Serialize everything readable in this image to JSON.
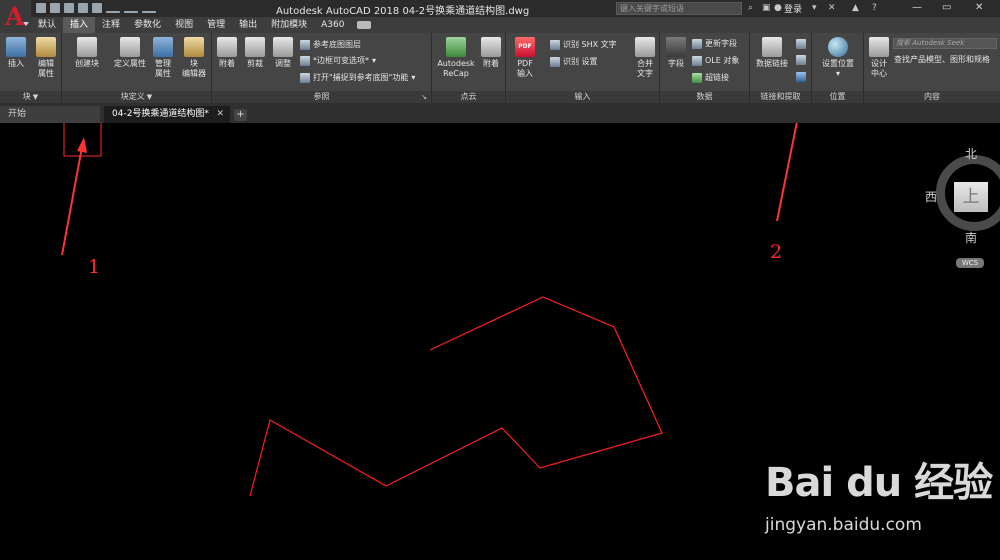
{
  "titlebar": {
    "document_title": "Autodesk AutoCAD 2018    04-2号换乘通道结构图.dwg",
    "search_placeholder": "键入关键字或短语",
    "login_label": "登录"
  },
  "ribbon_tabs": [
    "默认",
    "插入",
    "注释",
    "参数化",
    "视图",
    "管理",
    "输出",
    "附加模块",
    "A360"
  ],
  "active_tab": "插入",
  "ribbon": {
    "block": {
      "label": "块",
      "insert": "插入",
      "edit_attr_1": "编辑",
      "edit_attr_2": "属性",
      "create_block": "创建块"
    },
    "block_def": {
      "label": "块定义",
      "define_attr": "定义属性",
      "manage_attr_1": "管理",
      "manage_attr_2": "属性",
      "block_editor_1": "块",
      "block_editor_2": "编辑器"
    },
    "reference": {
      "label": "参照",
      "attach": "附着",
      "clip": "剪裁",
      "adjust": "调整",
      "underlay_layers": "参考底图图层",
      "frame_options": "*边框可变选项*",
      "snap_underlay": "打开\"捕捉到参考底图\"功能"
    },
    "point_cloud": {
      "label": "点云",
      "recap_1": "Autodesk",
      "recap_2": "ReCap",
      "attach": "附着"
    },
    "import": {
      "label": "输入",
      "pdf_icon": "PDF",
      "pdf_import_1": "PDF",
      "pdf_import_2": "输入",
      "recognize_shx": "识别 SHX 文字",
      "recognize_settings": "识别 设置",
      "merge_text_1": "合并",
      "merge_text_2": "文字"
    },
    "data": {
      "label": "数据",
      "field": "字段",
      "update_fields": "更新字段",
      "ole_object": "OLE 对象",
      "hyperlink": "超链接"
    },
    "link_extract": {
      "label": "链接和提取",
      "data_link": "数据链接"
    },
    "location": {
      "label": "位置",
      "set_location": "设置位置"
    },
    "content": {
      "label": "内容",
      "design_center_1": "设计",
      "design_center_2": "中心",
      "seek_placeholder": "搜索 Autodesk Seek",
      "seek_desc": "查找产品模型、图形和规格"
    }
  },
  "file_tabs": {
    "start": "开始",
    "document": "04-2号换乘通道结构图*"
  },
  "viewcube": {
    "north": "北",
    "west": "西",
    "south": "南",
    "top": "上",
    "wcs": "WCS"
  },
  "annotations": {
    "label_1": "1",
    "label_2": "2"
  },
  "watermark": {
    "logo": "Bai du 经验",
    "url": "jingyan.baidu.com"
  },
  "colors": {
    "accent_red": "#d21d2b",
    "annotation_red": "#ff2a2a",
    "polyline": "#ff1e1e",
    "ribbon_bg": "#454545"
  },
  "drawing": {
    "polyline_color": "#ff1e1e"
  }
}
